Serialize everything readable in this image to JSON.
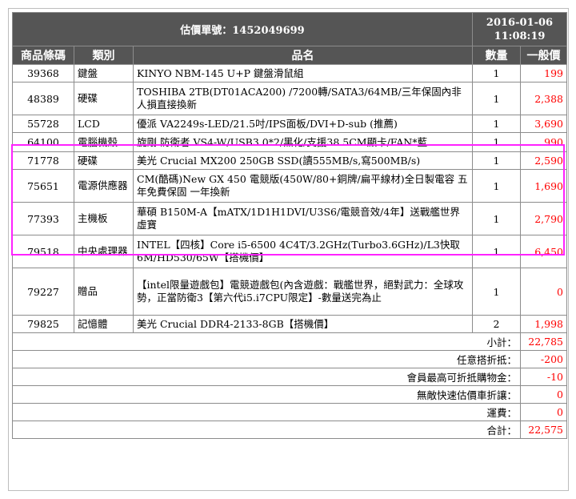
{
  "quote": {
    "title_label": "估價單號：",
    "number": "1452049699",
    "date": "2016-01-06",
    "time": "11:08:19"
  },
  "columns": {
    "code": "商品條碼",
    "category": "類別",
    "name": "品名",
    "qty": "數量",
    "price": "一般價"
  },
  "items": [
    {
      "code": "39368",
      "category": "鍵盤",
      "name": "KINYO NBM-145 U+P 鍵盤滑鼠組",
      "qty": "1",
      "price": "199"
    },
    {
      "code": "48389",
      "category": "硬碟",
      "name": "TOSHIBA 2TB(DT01ACA200) /7200轉/SATA3/64MB/三年保固內非人損直接換新",
      "qty": "1",
      "price": "2,388"
    },
    {
      "code": "55728",
      "category": "LCD",
      "name": "優派 VA2249s-LED/21.5吋/IPS面板/DVI+D-sub (推薦)",
      "qty": "1",
      "price": "3,690"
    },
    {
      "code": "64100",
      "category": "電腦機殼",
      "name": "旋剛 防衛者 VS4-W/USB3.0*2/黑化/支援38.5CM顯卡/FAN*藍",
      "qty": "1",
      "price": "990"
    },
    {
      "code": "71778",
      "category": "硬碟",
      "name": "美光 Crucial MX200 250GB SSD(讀555MB/s,寫500MB/s)",
      "qty": "1",
      "price": "2,590"
    },
    {
      "code": "75651",
      "category": "電源供應器",
      "name": "CM(酷碼)New GX 450 電競版(450W/80+銅牌/扁平線材)全日製電容 五年免費保固 一年換新",
      "qty": "1",
      "price": "1,690"
    },
    {
      "code": "77393",
      "category": "主機板",
      "name": "華碩 B150M-A【mATX/1D1H1DVI/U3S6/電競音效/4年】送戰艦世界虛寶",
      "qty": "1",
      "price": "2,790"
    },
    {
      "code": "79518",
      "category": "中央處理器",
      "name": "INTEL【四核】Core i5-6500 4C4T/3.2GHz(Turbo3.6GHz)/L3快取6M/HD530/65W【搭機價】",
      "qty": "1",
      "price": "6,450"
    },
    {
      "code": "79227",
      "category": "贈品",
      "name": "【intel限量遊戲包】電競遊戲包(內含遊戲：戰艦世界，絕對武力：全球攻勢，正當防衛3【第六代i5.i7CPU限定】-數量送完為止",
      "qty": "1",
      "price": "0"
    },
    {
      "code": "79825",
      "category": "記憶體",
      "name": "美光 Crucial DDR4-2133-8GB【搭機價】",
      "qty": "2",
      "price": "1,998"
    }
  ],
  "summary": [
    {
      "label": "小計：",
      "value": "22,785"
    },
    {
      "label": "任意搭折抵：",
      "value": "-200"
    },
    {
      "label": "會員最高可折抵購物金：",
      "value": "-10"
    },
    {
      "label": "無敵快速估價車折讓：",
      "value": "0"
    },
    {
      "label": "運費：",
      "value": "0"
    },
    {
      "label": "合計：",
      "value": "22,575"
    }
  ],
  "colors": {
    "header_bg": "#555555",
    "price": "#ff0000",
    "highlight": "#ff22ff"
  }
}
